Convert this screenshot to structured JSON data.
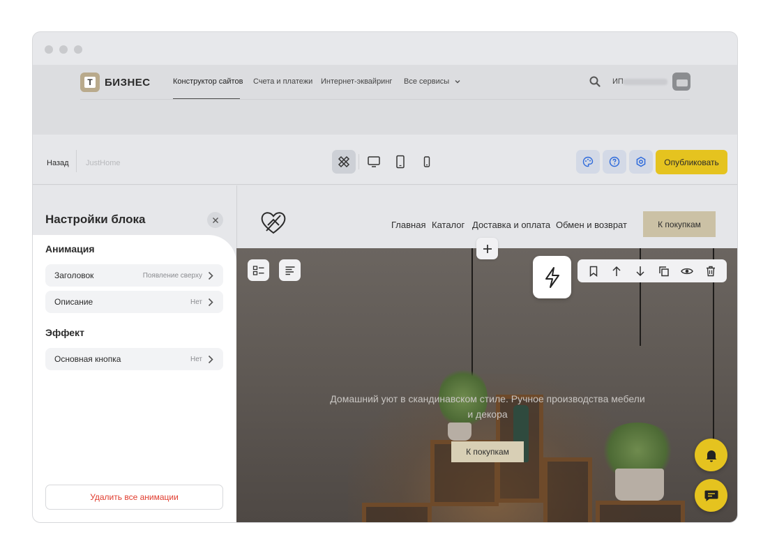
{
  "topnav": {
    "brand": "БИЗНЕС",
    "links": [
      "Конструктор сайтов",
      "Счета и платежи",
      "Интернет-эквайринг",
      "Все сервисы"
    ],
    "user_prefix": "ИП"
  },
  "toolbar": {
    "back_label": "Назад",
    "site_name": "JustHome",
    "publish_label": "Опубликовать"
  },
  "panel": {
    "title": "Настройки блока",
    "animation_heading": "Анимация",
    "animation_rows": [
      {
        "label": "Заголовок",
        "value": "Появление сверху"
      },
      {
        "label": "Описание",
        "value": "Нет"
      }
    ],
    "effect_heading": "Эффект",
    "effect_rows": [
      {
        "label": "Основная кнопка",
        "value": "Нет"
      }
    ],
    "delete_label": "Удалить все анимации"
  },
  "site": {
    "nav": [
      "Главная",
      "Каталог",
      "Доставка и оплата",
      "Обмен и возврат"
    ],
    "header_cta": "К покупкам",
    "hero_text": "Домашний уют в скандинавском стиле. Ручное производства мебели и декора",
    "hero_cta": "К покупкам"
  },
  "colors": {
    "accent": "#e5c31f",
    "danger": "#e03b2d",
    "site_cta": "#cbc1a5"
  }
}
